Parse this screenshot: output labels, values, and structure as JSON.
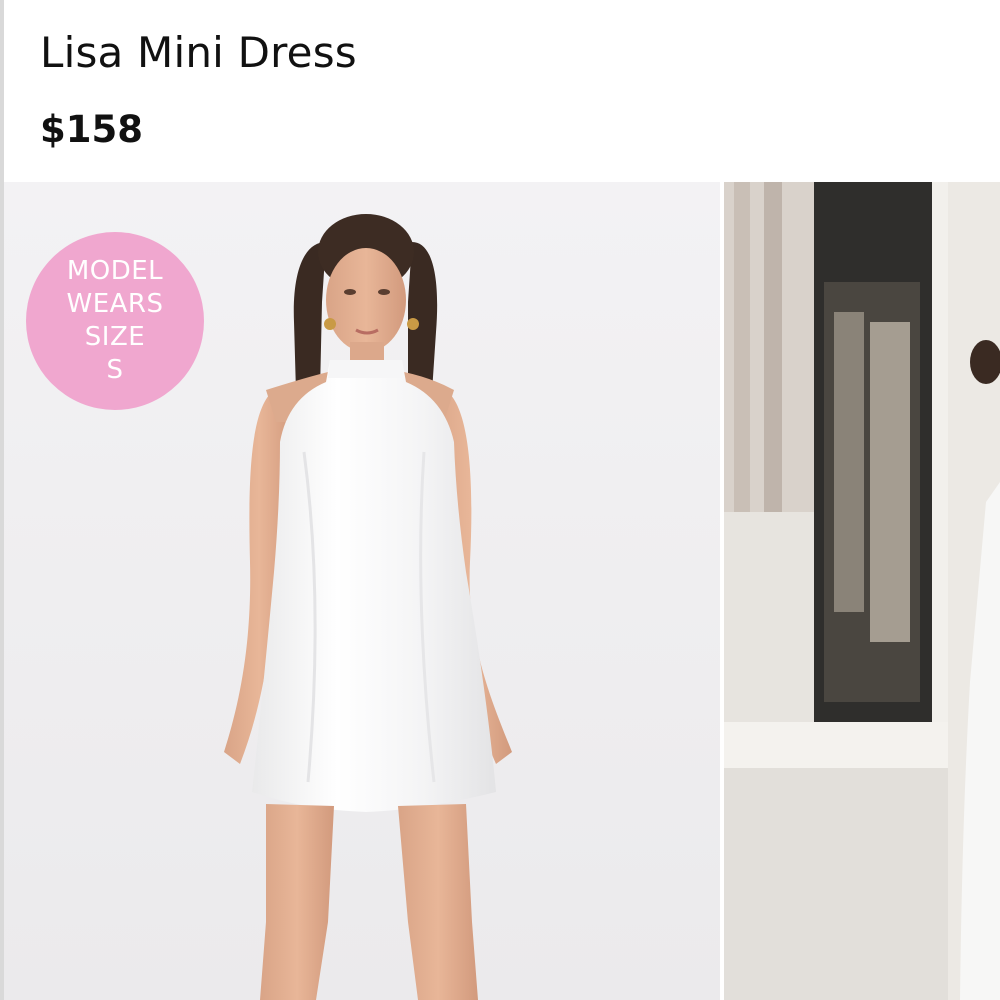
{
  "product": {
    "title": "Lisa Mini Dress",
    "price": "$158"
  },
  "gallery": {
    "badge_text": "MODEL WEARS SIZE S",
    "badge_color": "#f0a7cf",
    "images": [
      {
        "name": "studio-front-view"
      },
      {
        "name": "lifestyle-doorway-view"
      }
    ]
  }
}
